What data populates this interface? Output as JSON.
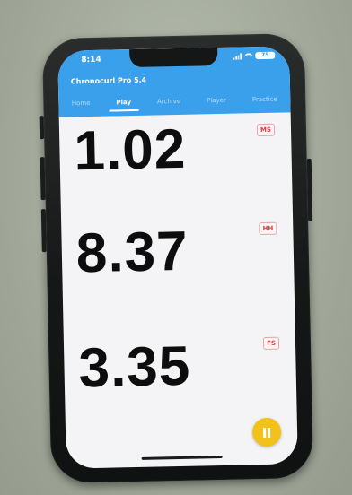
{
  "status_bar": {
    "time": "8:14",
    "battery": "75"
  },
  "app": {
    "title": "Chronocurl Pro 5.4"
  },
  "tabs": [
    {
      "label": "Home",
      "active": false
    },
    {
      "label": "Play",
      "active": true
    },
    {
      "label": "Archive",
      "active": false
    },
    {
      "label": "Player",
      "active": false
    },
    {
      "label": "Practice",
      "active": false
    }
  ],
  "timers": [
    {
      "value": "1.02",
      "badge": "MS"
    },
    {
      "value": "8.37",
      "badge": "HH"
    },
    {
      "value": "3.35",
      "badge": "FS"
    }
  ],
  "controls": {
    "pause_icon": "pause-icon"
  },
  "colors": {
    "header": "#3aa0ec",
    "badge_text": "#d04040",
    "pause_button": "#f2c21b"
  }
}
